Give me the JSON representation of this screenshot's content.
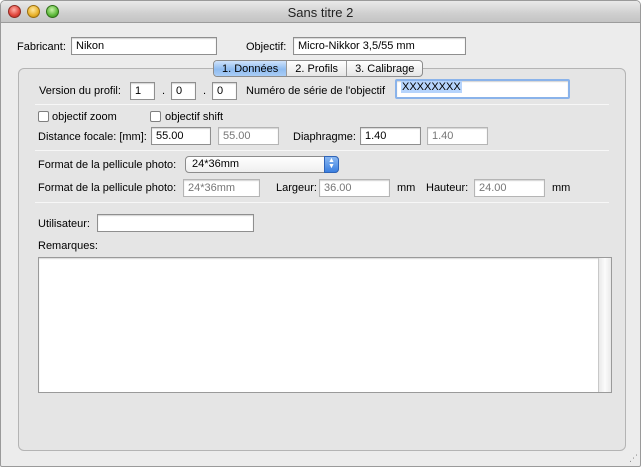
{
  "window": {
    "title": "Sans titre 2"
  },
  "header": {
    "manufacturer_label": "Fabricant:",
    "manufacturer_value": "Nikon",
    "lens_label": "Objectif:",
    "lens_value": "Micro-Nikkor 3,5/55 mm"
  },
  "tabs": [
    {
      "label": "1. Données",
      "active": true
    },
    {
      "label": "2. Profils",
      "active": false
    },
    {
      "label": "3. Calibrage",
      "active": false
    }
  ],
  "profile": {
    "version_label": "Version du profil:",
    "version": [
      "1",
      "0",
      "0"
    ],
    "dot": ".",
    "serial_label": "Numéro de série de l'objectif",
    "serial_value": "XXXXXXXX"
  },
  "options": {
    "zoom_label": "objectif zoom",
    "zoom_checked": false,
    "shift_label": "objectif shift",
    "shift_checked": false
  },
  "focal": {
    "label": "Distance focale: [mm]:",
    "value": "55.00",
    "value2": "55.00",
    "aperture_label": "Diaphragme:",
    "aperture_value": "1.40",
    "aperture_value2": "1.40"
  },
  "film": {
    "format_label": "Format de la pellicule photo:",
    "format_selected": "24*36mm",
    "format_label2": "Format de la pellicule photo:",
    "format_value": "24*36mm",
    "width_label": "Largeur:",
    "width_value": "36.00",
    "height_label": "Hauteur:",
    "height_value": "24.00",
    "unit": "mm"
  },
  "user": {
    "label": "Utilisateur:",
    "value": ""
  },
  "remarks": {
    "label": "Remarques:",
    "value": ""
  }
}
